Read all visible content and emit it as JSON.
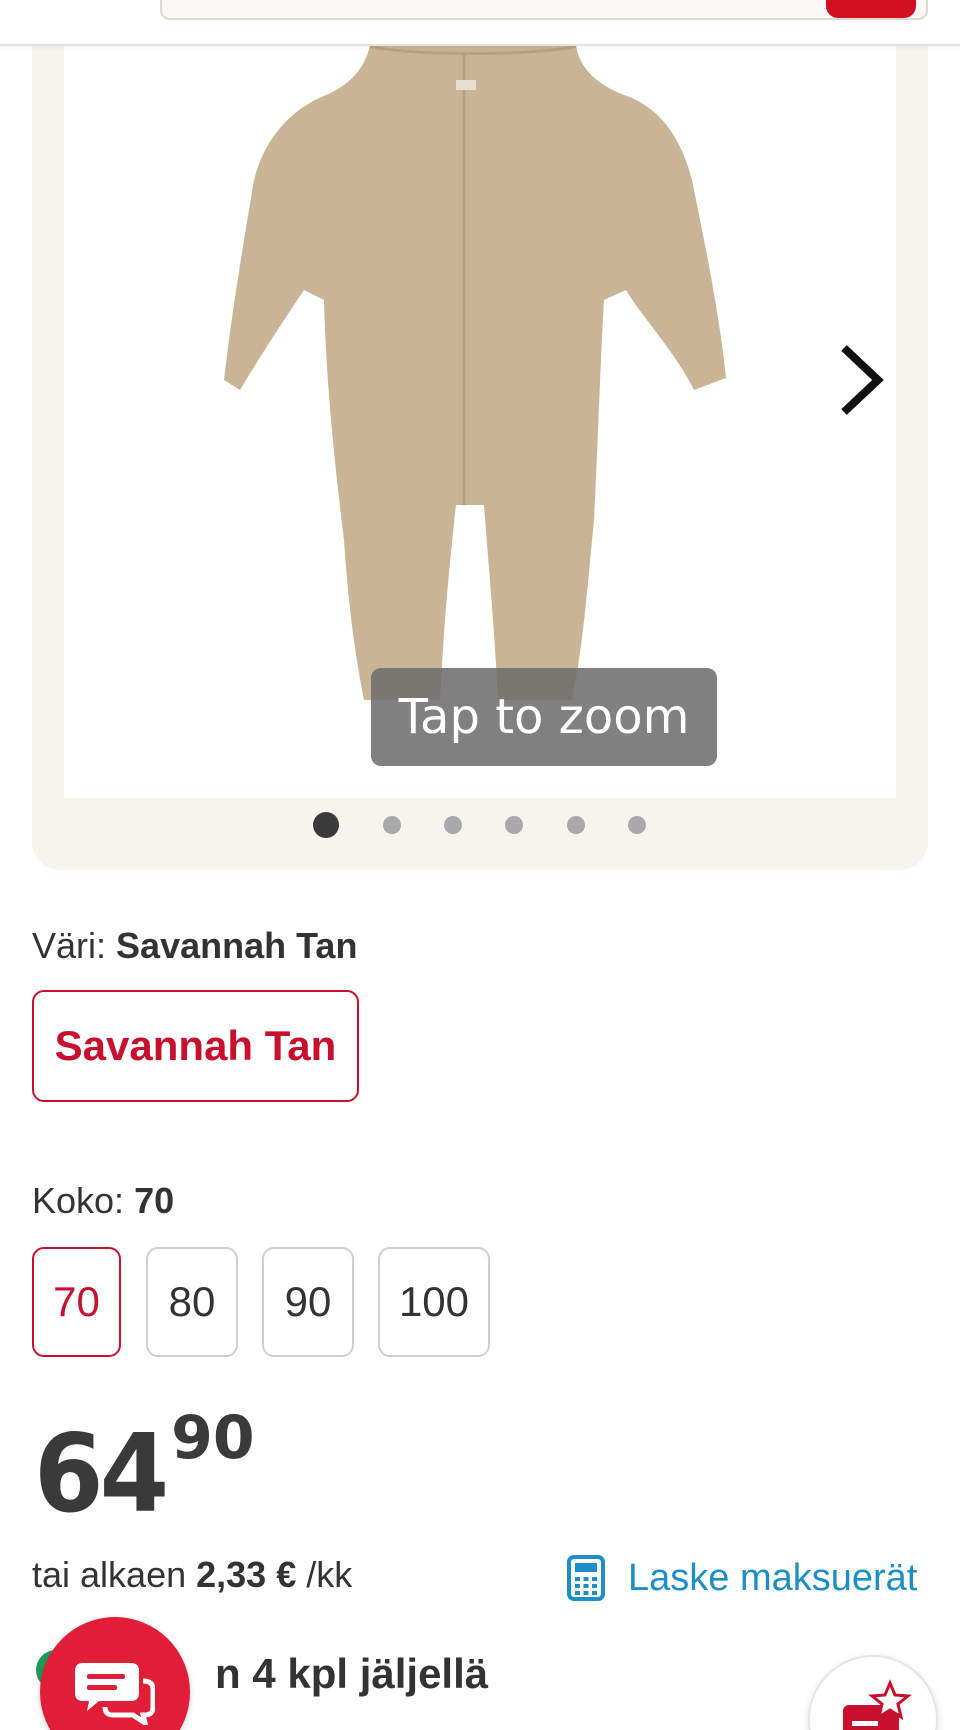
{
  "gallery": {
    "zoom_hint": "Tap to zoom",
    "total_images": 6,
    "active_index": 0
  },
  "color": {
    "label": "Väri:",
    "selected": "Savannah Tan",
    "options": [
      "Savannah Tan"
    ]
  },
  "size": {
    "label": "Koko:",
    "selected": "70",
    "options": [
      "70",
      "80",
      "90",
      "100"
    ]
  },
  "price": {
    "whole": "64",
    "cents": "90"
  },
  "installment": {
    "prefix": "tai alkaen",
    "amount": "2,33 €",
    "suffix": "/kk",
    "calc_link": "Laske maksuerät"
  },
  "stock": {
    "text": "n 4 kpl jäljellä"
  },
  "colors": {
    "brand_red": "#c8102e",
    "chat_red": "#e01e37",
    "link_blue": "#1d8fc6",
    "stock_green": "#1f9b57"
  },
  "icons": [
    "chevron-right-icon",
    "calculator-icon",
    "chat-icon",
    "wishlist-star-icon"
  ]
}
